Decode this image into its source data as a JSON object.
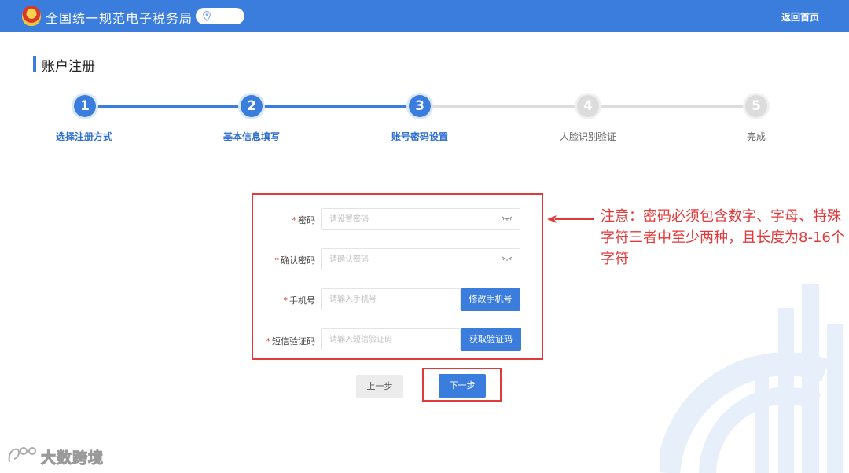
{
  "header": {
    "site_title": "全国统一规范电子税务局",
    "home_link": "返回首页",
    "location_icon": "location-pin-icon",
    "emblem_icon": "tax-emblem-icon"
  },
  "page": {
    "title": "账户注册"
  },
  "steps": [
    {
      "number": "1",
      "label": "选择注册方式",
      "state": "done"
    },
    {
      "number": "2",
      "label": "基本信息填写",
      "state": "done"
    },
    {
      "number": "3",
      "label": "账号密码设置",
      "state": "current"
    },
    {
      "number": "4",
      "label": "人脸识别验证",
      "state": "todo"
    },
    {
      "number": "5",
      "label": "完成",
      "state": "todo"
    }
  ],
  "form": {
    "password": {
      "label": "密码",
      "placeholder": "请设置密码"
    },
    "confirm_password": {
      "label": "确认密码",
      "placeholder": "请确认密码"
    },
    "phone": {
      "label": "手机号",
      "placeholder": "请输入手机号",
      "button": "修改手机号"
    },
    "sms_code": {
      "label": "短信验证码",
      "placeholder": "请输入短信验证码",
      "button": "获取验证码"
    },
    "required_mark": "*"
  },
  "actions": {
    "prev": "上一步",
    "next": "下一步"
  },
  "annotation": {
    "note": "注意：密码必须包含数字、字母、特殊字符三者中至少两种，且长度为8-16个字符"
  },
  "watermark": {
    "text": "大数跨境"
  },
  "colors": {
    "primary": "#3b7ddd",
    "highlight": "#e2393b",
    "inactive": "#dcdcdc"
  }
}
